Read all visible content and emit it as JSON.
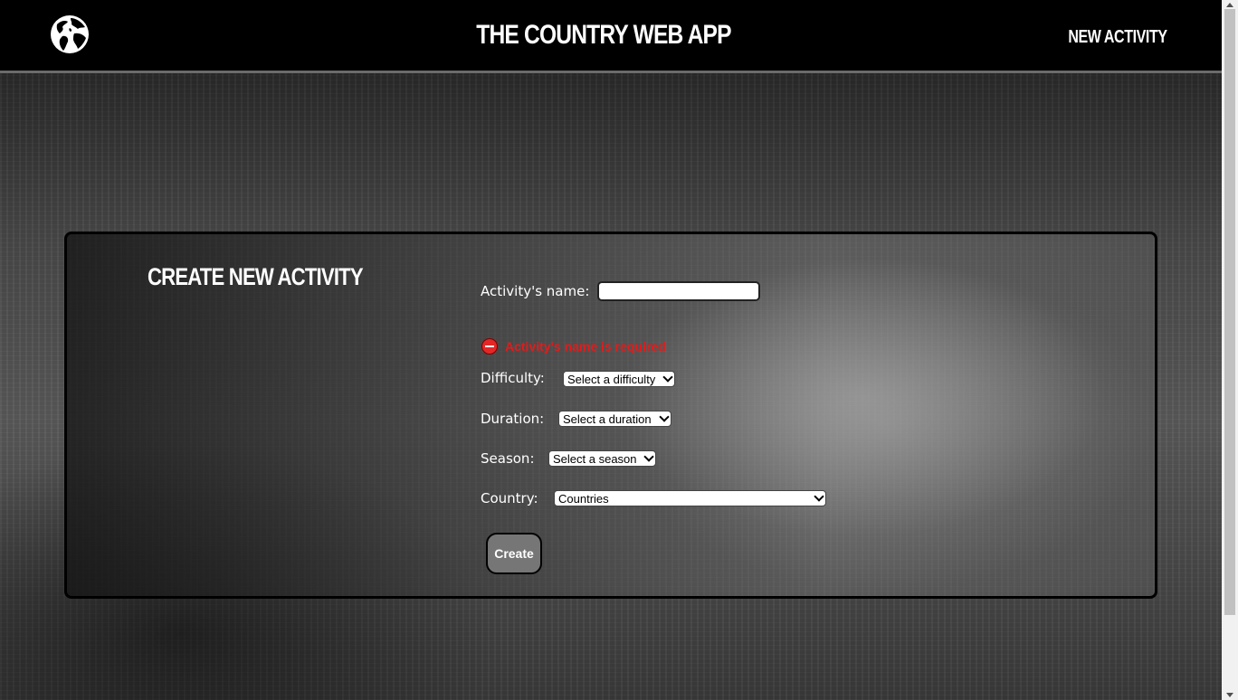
{
  "navbar": {
    "logo_icon": "globe-icon",
    "title": "THE COUNTRY WEB APP",
    "new_activity_link": "NEW ACTIVITY"
  },
  "form": {
    "title": "CREATE NEW ACTIVITY",
    "name_label": "Activity's name:",
    "name_value": "",
    "error_icon": "no-entry-icon",
    "error_message": "Activity's name is required",
    "difficulty_label": "Difficulty:",
    "difficulty_selected": "Select a difficulty",
    "duration_label": "Duration:",
    "duration_selected": "Select a duration",
    "season_label": "Season:",
    "season_selected": "Select a season",
    "country_label": "Country:",
    "country_selected": "Countries",
    "create_button": "Create"
  },
  "colors": {
    "navbar_bg": "#000000",
    "error": "#e51a1a",
    "button_bg": "#767676"
  }
}
